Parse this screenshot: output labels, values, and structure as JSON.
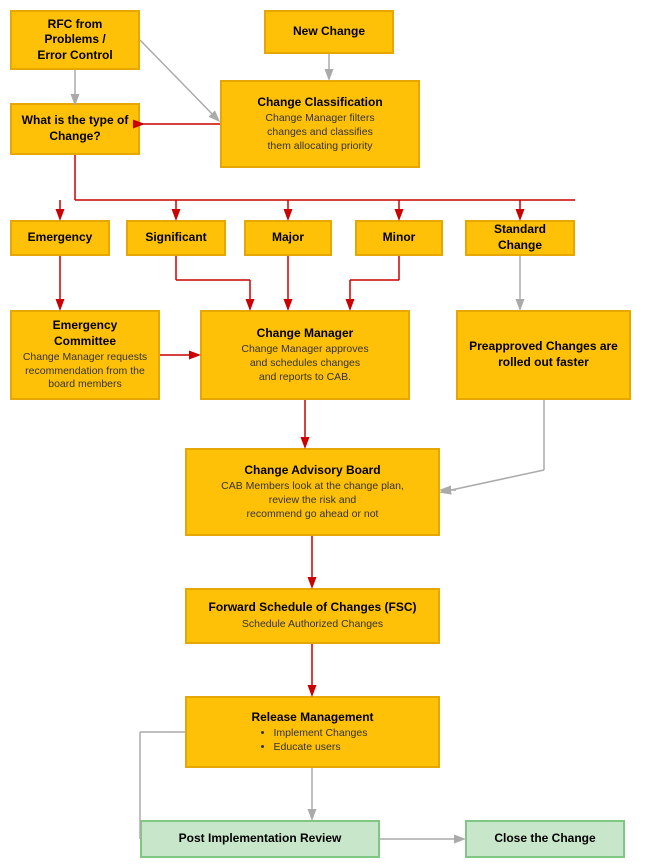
{
  "boxes": {
    "rfc": {
      "title": "RFC from Problems /\nError Control",
      "subtitle": ""
    },
    "new_change": {
      "title": "New Change",
      "subtitle": ""
    },
    "change_classification": {
      "title": "Change Classification",
      "subtitle": "Change Manager filters\nchanges and classifies\nthem allocating priority"
    },
    "what_type": {
      "title": "What is the type of\nChange?",
      "subtitle": ""
    },
    "emergency": {
      "title": "Emergency",
      "subtitle": ""
    },
    "significant": {
      "title": "Significant",
      "subtitle": ""
    },
    "major": {
      "title": "Major",
      "subtitle": ""
    },
    "minor": {
      "title": "Minor",
      "subtitle": ""
    },
    "standard_change": {
      "title": "Standard Change",
      "subtitle": ""
    },
    "emergency_committee": {
      "title": "Emergency Committee",
      "subtitle": "Change Manager requests\nrecommendation from the\nboard members"
    },
    "change_manager": {
      "title": "Change Manager",
      "subtitle": "Change Manager approves\nand schedules changes\nand reports to CAB."
    },
    "preapproved": {
      "title": "Preapproved Changes are\nrolled out faster",
      "subtitle": ""
    },
    "cab": {
      "title": "Change Advisory Board",
      "subtitle": "CAB Members look at the change plan,\nreview the risk and\nrecommend go ahead or not"
    },
    "fsc": {
      "title": "Forward Schedule of Changes (FSC)",
      "subtitle": "Schedule Authorized Changes"
    },
    "release_management": {
      "title": "Release Management",
      "subtitle_bullets": [
        "Implement Changes",
        "Educate users"
      ]
    },
    "post_implementation": {
      "title": "Post Implementation Review",
      "subtitle": ""
    },
    "close_change": {
      "title": "Close the Change",
      "subtitle": ""
    }
  },
  "colors": {
    "orange_bg": "#FFC107",
    "orange_border": "#E6A800",
    "green_bg": "#C8E6C9",
    "green_border": "#81C784",
    "arrow_red": "#CC0000",
    "arrow_gray": "#BBBBBB"
  }
}
